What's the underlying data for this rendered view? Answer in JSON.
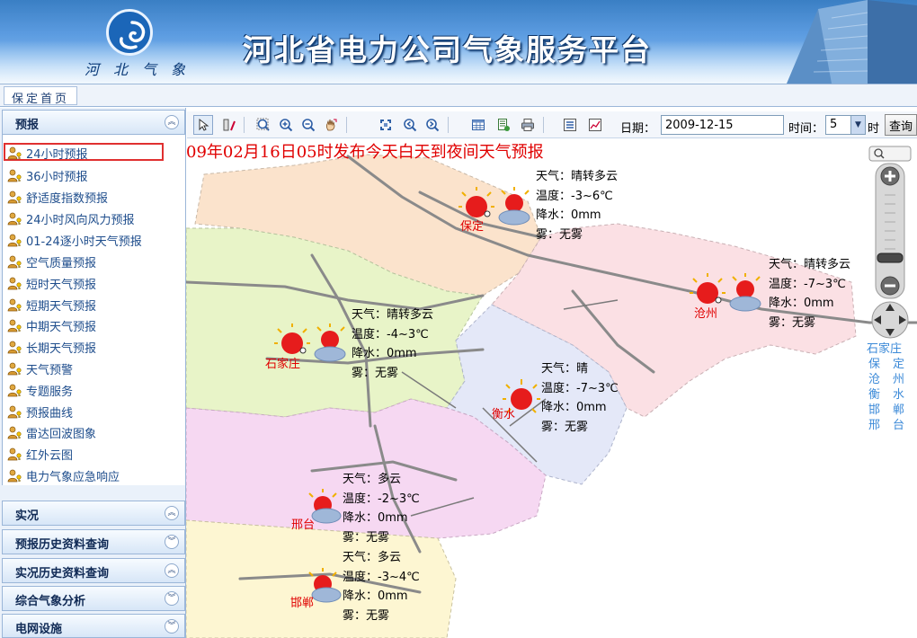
{
  "header": {
    "title": "河北省电力公司气象服务平台",
    "logo_text": "河北气象"
  },
  "breadcrumb": {
    "current": "保定首页"
  },
  "sidebar": {
    "active_panel": {
      "label": "预报",
      "items": [
        {
          "label": "24小时预报",
          "selected": true
        },
        {
          "label": "36小时预报"
        },
        {
          "label": "舒适度指数预报"
        },
        {
          "label": "24小时风向风力预报"
        },
        {
          "label": "01-24逐小时天气预报"
        },
        {
          "label": "空气质量预报"
        },
        {
          "label": "短时天气预报"
        },
        {
          "label": "短期天气预报"
        },
        {
          "label": "中期天气预报"
        },
        {
          "label": "长期天气预报"
        },
        {
          "label": "天气预警"
        },
        {
          "label": "专题服务"
        },
        {
          "label": "预报曲线"
        },
        {
          "label": "雷达回波图象"
        },
        {
          "label": "红外云图"
        },
        {
          "label": "电力气象应急响应"
        }
      ]
    },
    "panels": [
      {
        "label": "实况"
      },
      {
        "label": "预报历史资料查询"
      },
      {
        "label": "实况历史资料查询"
      },
      {
        "label": "综合气象分析"
      },
      {
        "label": "电网设施"
      }
    ]
  },
  "toolbar": {
    "date_label": "日期：",
    "date_value": "2009-12-15",
    "time_label": "时间：",
    "hour_value": "5",
    "hour_unit": "时",
    "query_label": "查询"
  },
  "map": {
    "headline": "09年02月16日05时发布今天白天到夜间天气预报",
    "stations": [
      {
        "name": "保定",
        "weather": "天气：晴转多云",
        "temp": "温度：-3~6℃",
        "precip": "降水：0mm",
        "fog": "雾：无雾"
      },
      {
        "name": "沧州",
        "weather": "天气：晴转多云",
        "temp": "温度：-7~3℃",
        "precip": "降水：0mm",
        "fog": "雾：无雾"
      },
      {
        "name": "石家庄",
        "weather": "天气：晴转多云",
        "temp": "温度：-4~3℃",
        "precip": "降水：0mm",
        "fog": "雾：无雾"
      },
      {
        "name": "衡水",
        "weather": "天气：晴",
        "temp": "温度：-7~3℃",
        "precip": "降水：0mm",
        "fog": "雾：无雾"
      },
      {
        "name": "邢台",
        "weather": "天气：多云",
        "temp": "温度：-2~3℃",
        "precip": "降水：0mm",
        "fog": "雾：无雾"
      },
      {
        "name": "邯郸",
        "weather": "天气：多云",
        "temp": "温度：-3~4℃",
        "precip": "降水：0mm",
        "fog": "雾：无雾"
      }
    ],
    "city_jump_rows": [
      [
        "石家庄"
      ],
      [
        "保",
        "定"
      ],
      [
        "沧",
        "州"
      ],
      [
        "衡",
        "水"
      ],
      [
        "邯",
        "郸"
      ],
      [
        "邢",
        "台"
      ]
    ]
  },
  "colors": {
    "headline": "#e00000",
    "city_label": "#e00000",
    "menu_text": "#1e4d8c",
    "selected_outline": "#e03030",
    "city_jump": "#3c8ad8"
  }
}
